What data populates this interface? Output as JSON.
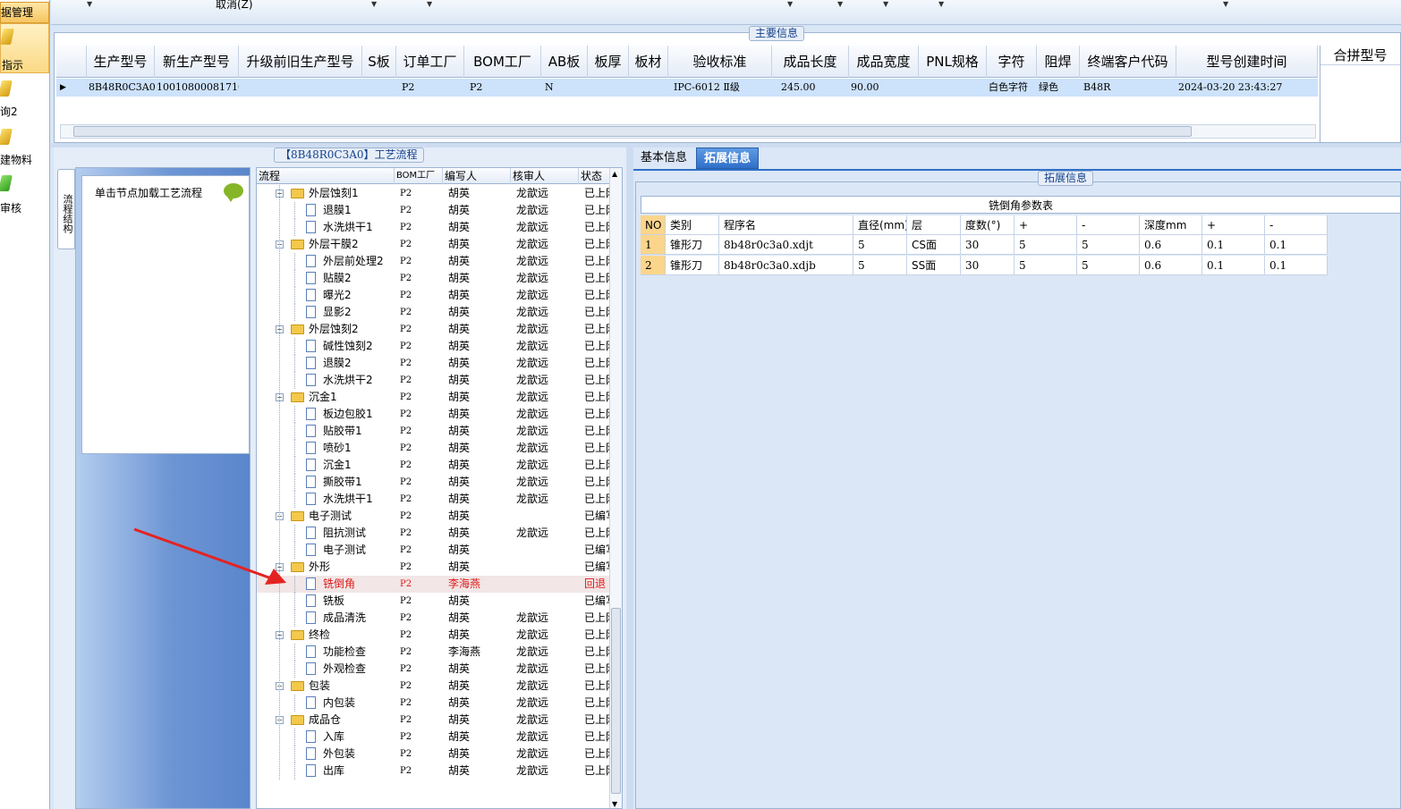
{
  "sidebar": {
    "selected_label": "据管理",
    "items": [
      {
        "label": "指示",
        "icon": "pencil-folder-icon"
      },
      {
        "label": "询2",
        "icon": "pencil-folder-icon"
      },
      {
        "label": "建物料",
        "icon": "pencil-folder-icon"
      },
      {
        "label": "审核",
        "icon": "green-check-icon"
      }
    ]
  },
  "topbar": {
    "cancel_label": "取消(Z)"
  },
  "main_info": {
    "title": "主要信息",
    "columns": [
      "生产型号",
      "新生产型号",
      "升级前旧生产型号",
      "S板",
      "订单工厂",
      "BOM工厂",
      "AB板",
      "板厚",
      "板材",
      "验收标准",
      "成品长度",
      "成品宽度",
      "PNL规格",
      "字符",
      "阻焊",
      "终端客户代码",
      "型号创建时间"
    ],
    "row": {
      "prod_model": "8B48R0C3A0",
      "new_model": "10010800081710",
      "old_model": "",
      "s_board": "",
      "order_factory": "P2",
      "bom_factory": "P2",
      "ab_board": "N",
      "thickness": "",
      "material": "",
      "standard": "IPC-6012 Ⅱ级",
      "length": "245.00",
      "width": "90.00",
      "pnl": "",
      "char": "白色字符",
      "solder": "绿色",
      "customer": "B48R",
      "created": "2024-03-20 23:43:27"
    },
    "merge_label": "合拼型号"
  },
  "flow_panel": {
    "title": "【8B48R0C3A0】工艺流程",
    "side_tab": "流程结构",
    "notice": "单击节点加载工艺流程",
    "headers": [
      "流程",
      "BOM工厂",
      "编写人",
      "核审人",
      "状态"
    ],
    "rows": [
      {
        "name": "外层蚀刻1",
        "folder": true,
        "f": "P2",
        "w": "胡英",
        "r": "龙歆远",
        "s": "已上网"
      },
      {
        "name": "退膜1",
        "folder": false,
        "f": "P2",
        "w": "胡英",
        "r": "龙歆远",
        "s": "已上网"
      },
      {
        "name": "水洗烘干1",
        "folder": false,
        "f": "P2",
        "w": "胡英",
        "r": "龙歆远",
        "s": "已上网"
      },
      {
        "name": "外层干膜2",
        "folder": true,
        "f": "P2",
        "w": "胡英",
        "r": "龙歆远",
        "s": "已上网"
      },
      {
        "name": "外层前处理2",
        "folder": false,
        "f": "P2",
        "w": "胡英",
        "r": "龙歆远",
        "s": "已上网"
      },
      {
        "name": "贴膜2",
        "folder": false,
        "f": "P2",
        "w": "胡英",
        "r": "龙歆远",
        "s": "已上网"
      },
      {
        "name": "曝光2",
        "folder": false,
        "f": "P2",
        "w": "胡英",
        "r": "龙歆远",
        "s": "已上网"
      },
      {
        "name": "显影2",
        "folder": false,
        "f": "P2",
        "w": "胡英",
        "r": "龙歆远",
        "s": "已上网"
      },
      {
        "name": "外层蚀刻2",
        "folder": true,
        "f": "P2",
        "w": "胡英",
        "r": "龙歆远",
        "s": "已上网"
      },
      {
        "name": "碱性蚀刻2",
        "folder": false,
        "f": "P2",
        "w": "胡英",
        "r": "龙歆远",
        "s": "已上网"
      },
      {
        "name": "退膜2",
        "folder": false,
        "f": "P2",
        "w": "胡英",
        "r": "龙歆远",
        "s": "已上网"
      },
      {
        "name": "水洗烘干2",
        "folder": false,
        "f": "P2",
        "w": "胡英",
        "r": "龙歆远",
        "s": "已上网"
      },
      {
        "name": "沉金1",
        "folder": true,
        "f": "P2",
        "w": "胡英",
        "r": "龙歆远",
        "s": "已上网"
      },
      {
        "name": "板边包胶1",
        "folder": false,
        "f": "P2",
        "w": "胡英",
        "r": "龙歆远",
        "s": "已上网"
      },
      {
        "name": "贴胶带1",
        "folder": false,
        "f": "P2",
        "w": "胡英",
        "r": "龙歆远",
        "s": "已上网"
      },
      {
        "name": "喷砂1",
        "folder": false,
        "f": "P2",
        "w": "胡英",
        "r": "龙歆远",
        "s": "已上网"
      },
      {
        "name": "沉金1",
        "folder": false,
        "f": "P2",
        "w": "胡英",
        "r": "龙歆远",
        "s": "已上网"
      },
      {
        "name": "撕胶带1",
        "folder": false,
        "f": "P2",
        "w": "胡英",
        "r": "龙歆远",
        "s": "已上网"
      },
      {
        "name": "水洗烘干1",
        "folder": false,
        "f": "P2",
        "w": "胡英",
        "r": "龙歆远",
        "s": "已上网"
      },
      {
        "name": "电子测试",
        "folder": true,
        "f": "P2",
        "w": "胡英",
        "r": "",
        "s": "已编写"
      },
      {
        "name": "阻抗测试",
        "folder": false,
        "f": "P2",
        "w": "胡英",
        "r": "龙歆远",
        "s": "已上网"
      },
      {
        "name": "电子测试",
        "folder": false,
        "f": "P2",
        "w": "胡英",
        "r": "",
        "s": "已编写"
      },
      {
        "name": "外形",
        "folder": true,
        "f": "P2",
        "w": "胡英",
        "r": "",
        "s": "已编写"
      },
      {
        "name": "铣倒角",
        "folder": false,
        "f": "P2",
        "w": "李海燕",
        "r": "",
        "s": "回退",
        "hl": true
      },
      {
        "name": "铣板",
        "folder": false,
        "f": "P2",
        "w": "胡英",
        "r": "",
        "s": "已编写"
      },
      {
        "name": "成品清洗",
        "folder": false,
        "f": "P2",
        "w": "胡英",
        "r": "龙歆远",
        "s": "已上网"
      },
      {
        "name": "终检",
        "folder": true,
        "f": "P2",
        "w": "胡英",
        "r": "龙歆远",
        "s": "已上网"
      },
      {
        "name": "功能检查",
        "folder": false,
        "f": "P2",
        "w": "李海燕",
        "r": "龙歆远",
        "s": "已上网"
      },
      {
        "name": "外观检查",
        "folder": false,
        "f": "P2",
        "w": "胡英",
        "r": "龙歆远",
        "s": "已上网"
      },
      {
        "name": "包装",
        "folder": true,
        "f": "P2",
        "w": "胡英",
        "r": "龙歆远",
        "s": "已上网"
      },
      {
        "name": "内包装",
        "folder": false,
        "f": "P2",
        "w": "胡英",
        "r": "龙歆远",
        "s": "已上网"
      },
      {
        "name": "成品仓",
        "folder": true,
        "f": "P2",
        "w": "胡英",
        "r": "龙歆远",
        "s": "已上网"
      },
      {
        "name": "入库",
        "folder": false,
        "f": "P2",
        "w": "胡英",
        "r": "龙歆远",
        "s": "已上网"
      },
      {
        "name": "外包装",
        "folder": false,
        "f": "P2",
        "w": "胡英",
        "r": "龙歆远",
        "s": "已上网"
      },
      {
        "name": "出库",
        "folder": false,
        "f": "P2",
        "w": "胡英",
        "r": "龙歆远",
        "s": "已上网"
      }
    ]
  },
  "right_panel": {
    "tabs": [
      "基本信息",
      "拓展信息"
    ],
    "ext_title": "拓展信息",
    "param_table_title": "铣倒角参数表",
    "param_headers": [
      "NO",
      "类别",
      "程序名",
      "直径(mm)",
      "层",
      "度数(°)",
      "+",
      "-",
      "深度mm",
      "+",
      "-"
    ],
    "param_rows": [
      [
        "1",
        "锥形刀",
        "8b48r0c3a0.xdjt",
        "5",
        "CS面",
        "30",
        "5",
        "5",
        "0.6",
        "0.1",
        "0.1"
      ],
      [
        "2",
        "锥形刀",
        "8b48r0c3a0.xdjb",
        "5",
        "SS面",
        "30",
        "5",
        "5",
        "0.6",
        "0.1",
        "0.1"
      ]
    ]
  },
  "colors": {
    "highlight_row": "#cde2fb",
    "rollback_text": "#e01818",
    "tab_active": "#2f6fc8",
    "arrow": "#e52222"
  }
}
